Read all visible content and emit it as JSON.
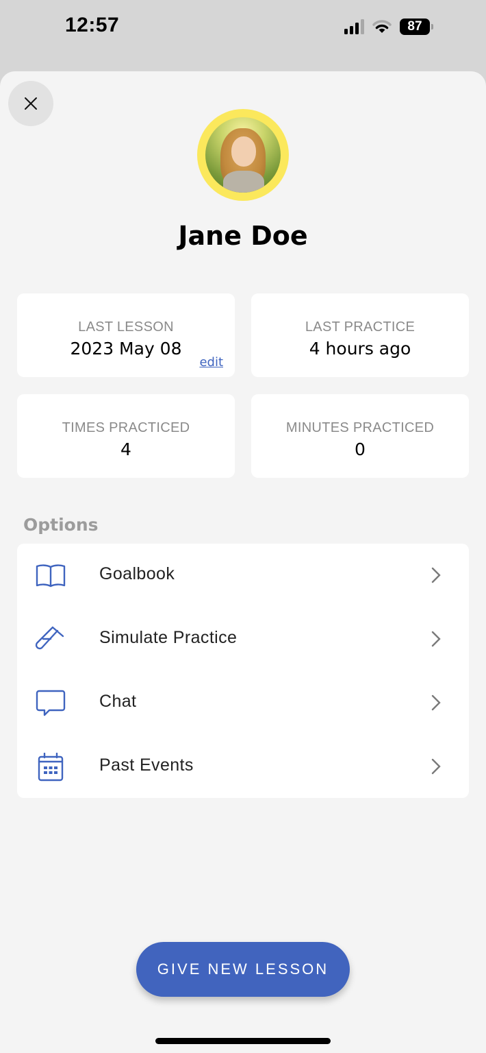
{
  "status_bar": {
    "time": "12:57",
    "battery": "87",
    "signal_bars_active": 3,
    "signal_bars_total": 4
  },
  "header": {
    "close_icon": "close-icon",
    "student_name": "Jane Doe",
    "avatar_ring_color": "#fbe85c"
  },
  "stats": {
    "last_lesson": {
      "label": "LAST LESSON",
      "value": "2023 May 08",
      "edit_label": "edit"
    },
    "last_practice": {
      "label": "LAST PRACTICE",
      "value": "4 hours ago"
    },
    "times_practiced": {
      "label": "TIMES PRACTICED",
      "value": "4"
    },
    "minutes_practiced": {
      "label": "MINUTES PRACTICED",
      "value": "0"
    }
  },
  "options": {
    "heading": "Options",
    "items": [
      {
        "label": "Goalbook",
        "icon": "book-open-icon"
      },
      {
        "label": "Simulate Practice",
        "icon": "test-tube-icon"
      },
      {
        "label": "Chat",
        "icon": "chat-bubble-icon"
      },
      {
        "label": "Past Events",
        "icon": "calendar-icon"
      }
    ]
  },
  "cta": {
    "label": "GIVE NEW LESSON"
  },
  "colors": {
    "accent": "#4164be",
    "icon_blue": "#3f64bf",
    "background": "#f4f4f4"
  }
}
